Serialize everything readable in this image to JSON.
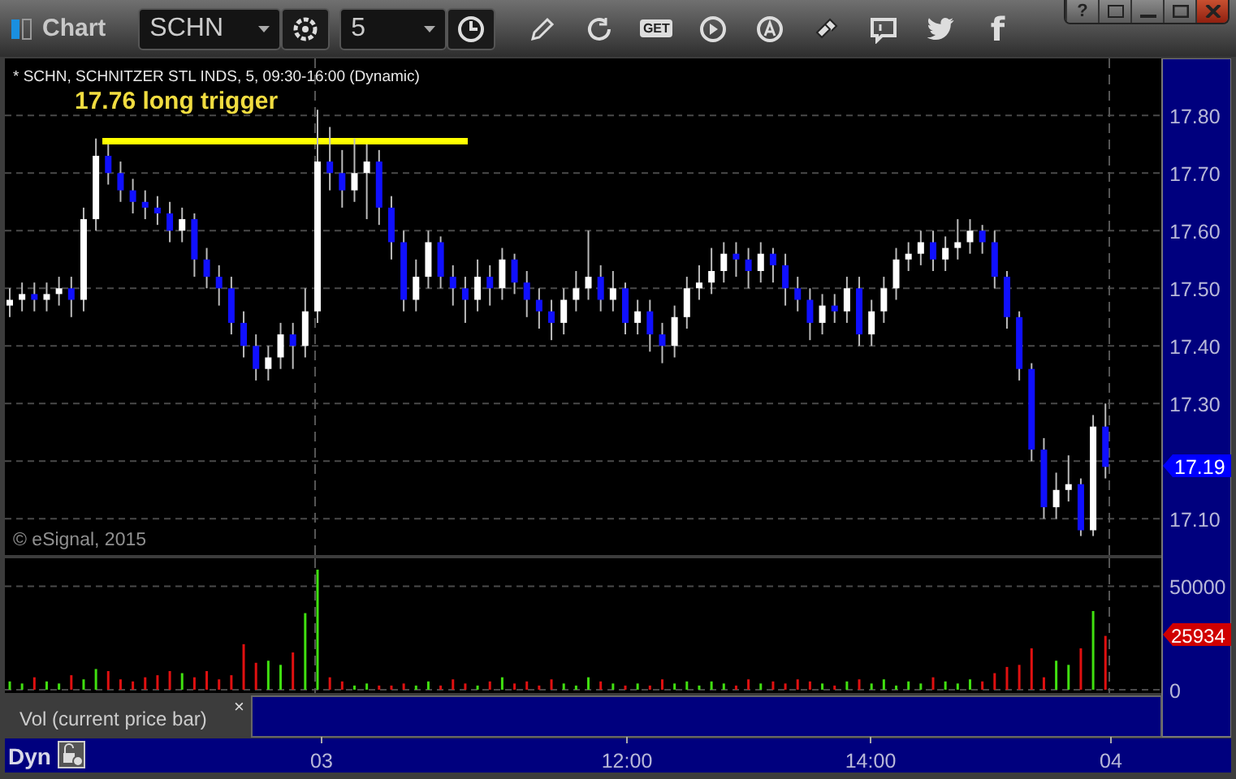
{
  "window": {
    "title": "Chart",
    "symbol": "SCHN",
    "interval": "5",
    "help": "?",
    "get_label": "GET",
    "facebook": "f"
  },
  "chart": {
    "header": "* SCHN, SCHNITZER STL INDS, 5, 09:30-16:00 (Dynamic)",
    "annotation": "17.76 long trigger",
    "copyright": "© eSignal, 2015",
    "last_price": "17.19",
    "chart_data": {
      "type": "candlestick",
      "ylim": [
        17.037,
        17.899
      ],
      "categories": [
        null,
        null,
        null,
        null,
        null,
        null,
        null,
        null,
        null,
        null,
        null,
        null,
        null,
        null,
        null,
        null,
        null,
        null,
        null,
        null,
        null,
        null,
        null,
        null,
        null,
        null,
        null,
        null,
        null,
        null,
        null,
        null,
        null,
        null,
        null,
        null,
        null,
        null,
        null,
        null,
        null,
        null,
        null,
        null,
        null,
        null,
        null,
        null,
        null,
        null,
        null,
        null,
        null,
        null,
        null,
        null,
        null,
        null,
        null,
        null,
        null,
        null,
        null,
        null,
        null,
        null,
        null,
        null,
        null,
        null,
        null,
        null,
        null,
        null,
        null,
        null,
        null,
        null,
        null,
        null,
        null,
        null,
        null,
        null,
        null,
        null,
        null,
        null,
        null,
        null
      ],
      "yticks": [
        {
          "value": 17.8,
          "label": "17.80"
        },
        {
          "value": 17.7,
          "label": "17.70"
        },
        {
          "value": 17.6,
          "label": "17.60"
        },
        {
          "value": 17.5,
          "label": "17.50"
        },
        {
          "value": 17.4,
          "label": "17.40"
        },
        {
          "value": 17.3,
          "label": "17.30"
        },
        {
          "value": 17.1,
          "label": "17.10"
        }
      ],
      "ohlc": [
        [
          17.47,
          17.5,
          17.45,
          17.48
        ],
        [
          17.48,
          17.51,
          17.46,
          17.49
        ],
        [
          17.49,
          17.51,
          17.46,
          17.48
        ],
        [
          17.48,
          17.51,
          17.46,
          17.49
        ],
        [
          17.49,
          17.52,
          17.47,
          17.5
        ],
        [
          17.5,
          17.52,
          17.45,
          17.48
        ],
        [
          17.48,
          17.64,
          17.46,
          17.62
        ],
        [
          17.62,
          17.76,
          17.6,
          17.73
        ],
        [
          17.73,
          17.75,
          17.68,
          17.7
        ],
        [
          17.7,
          17.72,
          17.65,
          17.67
        ],
        [
          17.67,
          17.69,
          17.63,
          17.65
        ],
        [
          17.65,
          17.67,
          17.62,
          17.64
        ],
        [
          17.64,
          17.66,
          17.61,
          17.63
        ],
        [
          17.63,
          17.65,
          17.58,
          17.6
        ],
        [
          17.6,
          17.64,
          17.58,
          17.62
        ],
        [
          17.62,
          17.63,
          17.52,
          17.55
        ],
        [
          17.55,
          17.57,
          17.5,
          17.52
        ],
        [
          17.52,
          17.54,
          17.47,
          17.5
        ],
        [
          17.5,
          17.52,
          17.42,
          17.44
        ],
        [
          17.44,
          17.46,
          17.38,
          17.4
        ],
        [
          17.4,
          17.42,
          17.34,
          17.36
        ],
        [
          17.36,
          17.4,
          17.34,
          17.38
        ],
        [
          17.38,
          17.44,
          17.36,
          17.42
        ],
        [
          17.42,
          17.44,
          17.36,
          17.4
        ],
        [
          17.4,
          17.5,
          17.38,
          17.46
        ],
        [
          17.46,
          17.81,
          17.44,
          17.72
        ],
        [
          17.72,
          17.78,
          17.67,
          17.7
        ],
        [
          17.7,
          17.74,
          17.64,
          17.67
        ],
        [
          17.67,
          17.76,
          17.65,
          17.7
        ],
        [
          17.7,
          17.75,
          17.62,
          17.72
        ],
        [
          17.72,
          17.74,
          17.61,
          17.64
        ],
        [
          17.64,
          17.66,
          17.55,
          17.58
        ],
        [
          17.58,
          17.6,
          17.46,
          17.48
        ],
        [
          17.48,
          17.55,
          17.46,
          17.52
        ],
        [
          17.52,
          17.6,
          17.5,
          17.58
        ],
        [
          17.58,
          17.59,
          17.5,
          17.52
        ],
        [
          17.52,
          17.54,
          17.47,
          17.5
        ],
        [
          17.5,
          17.52,
          17.44,
          17.48
        ],
        [
          17.48,
          17.55,
          17.46,
          17.52
        ],
        [
          17.52,
          17.54,
          17.47,
          17.5
        ],
        [
          17.5,
          17.57,
          17.48,
          17.55
        ],
        [
          17.55,
          17.56,
          17.49,
          17.51
        ],
        [
          17.51,
          17.53,
          17.45,
          17.48
        ],
        [
          17.48,
          17.5,
          17.43,
          17.46
        ],
        [
          17.46,
          17.48,
          17.41,
          17.44
        ],
        [
          17.44,
          17.5,
          17.42,
          17.48
        ],
        [
          17.48,
          17.53,
          17.46,
          17.5
        ],
        [
          17.5,
          17.6,
          17.48,
          17.52
        ],
        [
          17.52,
          17.54,
          17.46,
          17.48
        ],
        [
          17.48,
          17.53,
          17.46,
          17.5
        ],
        [
          17.5,
          17.51,
          17.42,
          17.44
        ],
        [
          17.44,
          17.48,
          17.42,
          17.46
        ],
        [
          17.46,
          17.48,
          17.39,
          17.42
        ],
        [
          17.42,
          17.44,
          17.37,
          17.4
        ],
        [
          17.4,
          17.47,
          17.38,
          17.45
        ],
        [
          17.45,
          17.52,
          17.43,
          17.5
        ],
        [
          17.5,
          17.54,
          17.48,
          17.51
        ],
        [
          17.51,
          17.57,
          17.49,
          17.53
        ],
        [
          17.53,
          17.58,
          17.51,
          17.56
        ],
        [
          17.56,
          17.58,
          17.52,
          17.55
        ],
        [
          17.55,
          17.57,
          17.5,
          17.53
        ],
        [
          17.53,
          17.58,
          17.51,
          17.56
        ],
        [
          17.56,
          17.57,
          17.51,
          17.54
        ],
        [
          17.54,
          17.56,
          17.47,
          17.5
        ],
        [
          17.5,
          17.52,
          17.46,
          17.48
        ],
        [
          17.48,
          17.5,
          17.41,
          17.44
        ],
        [
          17.44,
          17.49,
          17.42,
          17.47
        ],
        [
          17.47,
          17.49,
          17.44,
          17.46
        ],
        [
          17.46,
          17.52,
          17.44,
          17.5
        ],
        [
          17.5,
          17.52,
          17.4,
          17.42
        ],
        [
          17.42,
          17.48,
          17.4,
          17.46
        ],
        [
          17.46,
          17.52,
          17.44,
          17.5
        ],
        [
          17.5,
          17.57,
          17.48,
          17.55
        ],
        [
          17.55,
          17.58,
          17.53,
          17.56
        ],
        [
          17.56,
          17.6,
          17.54,
          17.58
        ],
        [
          17.58,
          17.6,
          17.53,
          17.55
        ],
        [
          17.55,
          17.59,
          17.53,
          17.57
        ],
        [
          17.57,
          17.62,
          17.55,
          17.58
        ],
        [
          17.58,
          17.62,
          17.56,
          17.6
        ],
        [
          17.6,
          17.61,
          17.56,
          17.58
        ],
        [
          17.58,
          17.6,
          17.5,
          17.52
        ],
        [
          17.52,
          17.53,
          17.43,
          17.45
        ],
        [
          17.45,
          17.46,
          17.34,
          17.36
        ],
        [
          17.36,
          17.37,
          17.2,
          17.22
        ],
        [
          17.22,
          17.24,
          17.1,
          17.12
        ],
        [
          17.12,
          17.18,
          17.1,
          17.15
        ],
        [
          17.15,
          17.21,
          17.13,
          17.16
        ],
        [
          17.16,
          17.17,
          17.07,
          17.08
        ],
        [
          17.08,
          17.28,
          17.07,
          17.26
        ],
        [
          17.26,
          17.3,
          17.17,
          17.19
        ]
      ]
    }
  },
  "volume": {
    "last_volume": "25934",
    "legend": "Vol (current price bar)",
    "close": "×",
    "chart_data": {
      "type": "bar",
      "ylim": [
        -1587,
        63492
      ],
      "categories": [
        null,
        null,
        null,
        null,
        null,
        null,
        null,
        null,
        null,
        null,
        null,
        null,
        null,
        null,
        null,
        null,
        null,
        null,
        null,
        null,
        null,
        null,
        null,
        null,
        null,
        null,
        null,
        null,
        null,
        null,
        null,
        null,
        null,
        null,
        null,
        null,
        null,
        null,
        null,
        null,
        null,
        null,
        null,
        null,
        null,
        null,
        null,
        null,
        null,
        null,
        null,
        null,
        null,
        null,
        null,
        null,
        null,
        null,
        null,
        null,
        null,
        null,
        null,
        null,
        null,
        null,
        null,
        null,
        null,
        null,
        null,
        null,
        null,
        null,
        null,
        null,
        null,
        null,
        null,
        null,
        null,
        null,
        null,
        null,
        null,
        null,
        null,
        null,
        null,
        null
      ],
      "yticks": [
        {
          "value": 50000,
          "label": "50000"
        },
        {
          "value": 0,
          "label": "0"
        }
      ],
      "values": [
        4000,
        3000,
        6000,
        4000,
        3000,
        7000,
        5000,
        10000,
        9000,
        5000,
        4000,
        6000,
        7000,
        9000,
        8000,
        6000,
        9000,
        5000,
        7000,
        22000,
        13000,
        14000,
        12000,
        18000,
        37000,
        58000,
        6000,
        4000,
        2000,
        3000,
        2000,
        2000,
        3000,
        2000,
        4000,
        2000,
        5000,
        3000,
        2000,
        4000,
        6000,
        3000,
        4000,
        2000,
        5000,
        3000,
        2000,
        6000,
        4000,
        3000,
        2000,
        3000,
        2000,
        5000,
        3000,
        4000,
        2000,
        4000,
        3000,
        2000,
        5000,
        3000,
        4000,
        3000,
        5000,
        4000,
        3000,
        2000,
        4000,
        5000,
        3000,
        5000,
        2000,
        4000,
        3000,
        6000,
        4000,
        3000,
        5000,
        4000,
        8000,
        11000,
        12000,
        20000,
        6000,
        14000,
        12000,
        20000,
        38000,
        26000
      ]
    }
  },
  "time_axis": {
    "mode": "Dyn",
    "labels": [
      "03",
      "12:00",
      "14:00",
      "04"
    ]
  }
}
